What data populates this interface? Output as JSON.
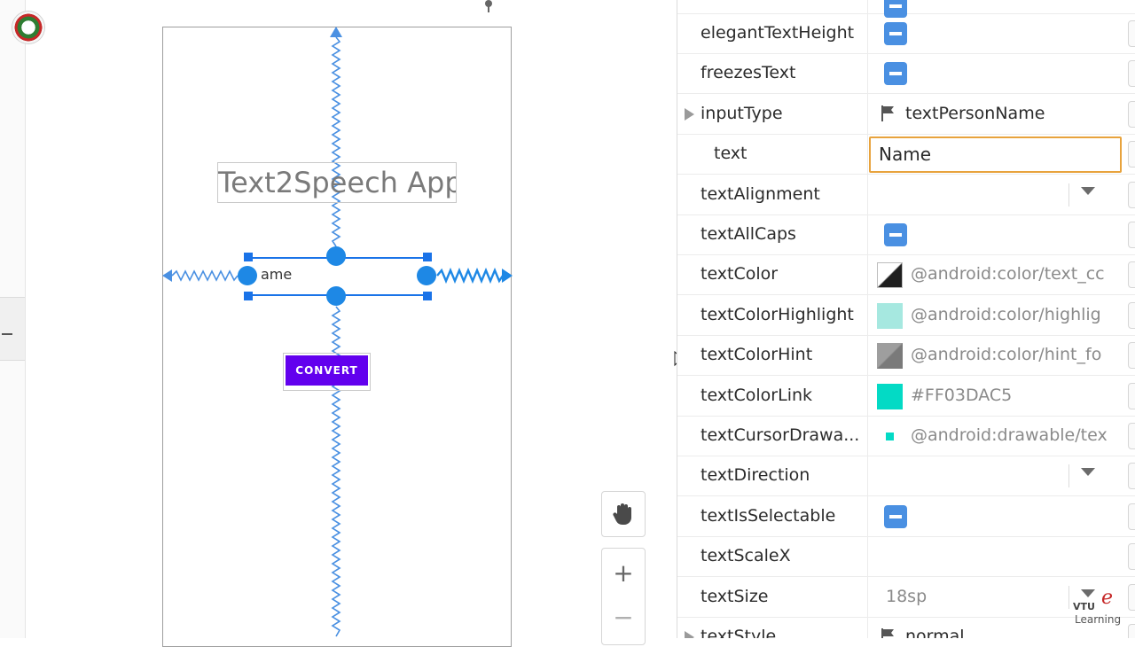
{
  "design_surface": {
    "title_text": "Text2Speech App",
    "edit_text_value": "ame",
    "button_label": "CONVERT",
    "accent_color": "#6200ee",
    "selection_color": "#1e88e5",
    "tools": {
      "pan_icon": "hand-icon",
      "zoom_in_label": "+",
      "zoom_out_label": "−"
    }
  },
  "attributes": [
    {
      "name": "elegantTextHeight",
      "kind": "flag"
    },
    {
      "name": "freezesText",
      "kind": "flag"
    },
    {
      "name": "inputType",
      "kind": "flagged-value",
      "value": "textPersonName",
      "expandable": true
    },
    {
      "name": "text",
      "kind": "input",
      "value": "Name"
    },
    {
      "name": "textAlignment",
      "kind": "dropdown"
    },
    {
      "name": "textAllCaps",
      "kind": "flag"
    },
    {
      "name": "textColor",
      "kind": "color",
      "value": "@android:color/text_cc",
      "swatch": "#1f1f1f"
    },
    {
      "name": "textColorHighlight",
      "kind": "color",
      "value": "@android:color/highlig",
      "swatch": "#a6e8e0"
    },
    {
      "name": "textColorHint",
      "kind": "color",
      "value": "@android:color/hint_fo",
      "swatch": "#7a7a7a"
    },
    {
      "name": "textColorLink",
      "kind": "color",
      "value": "#FF03DAC5",
      "swatch": "#03dac5"
    },
    {
      "name": "textCursorDrawa...",
      "kind": "drawable",
      "value": "@android:drawable/tex",
      "swatch": "#03dac5"
    },
    {
      "name": "textDirection",
      "kind": "dropdown"
    },
    {
      "name": "textIsSelectable",
      "kind": "flag"
    },
    {
      "name": "textScaleX",
      "kind": "empty"
    },
    {
      "name": "textSize",
      "kind": "dropdown-value",
      "value": "18sp"
    },
    {
      "name": "textStyle",
      "kind": "flagged-value",
      "value": "normal",
      "expandable": true
    }
  ],
  "watermark": {
    "line1": "VTU",
    "letter": "e",
    "line2": "Learning"
  }
}
